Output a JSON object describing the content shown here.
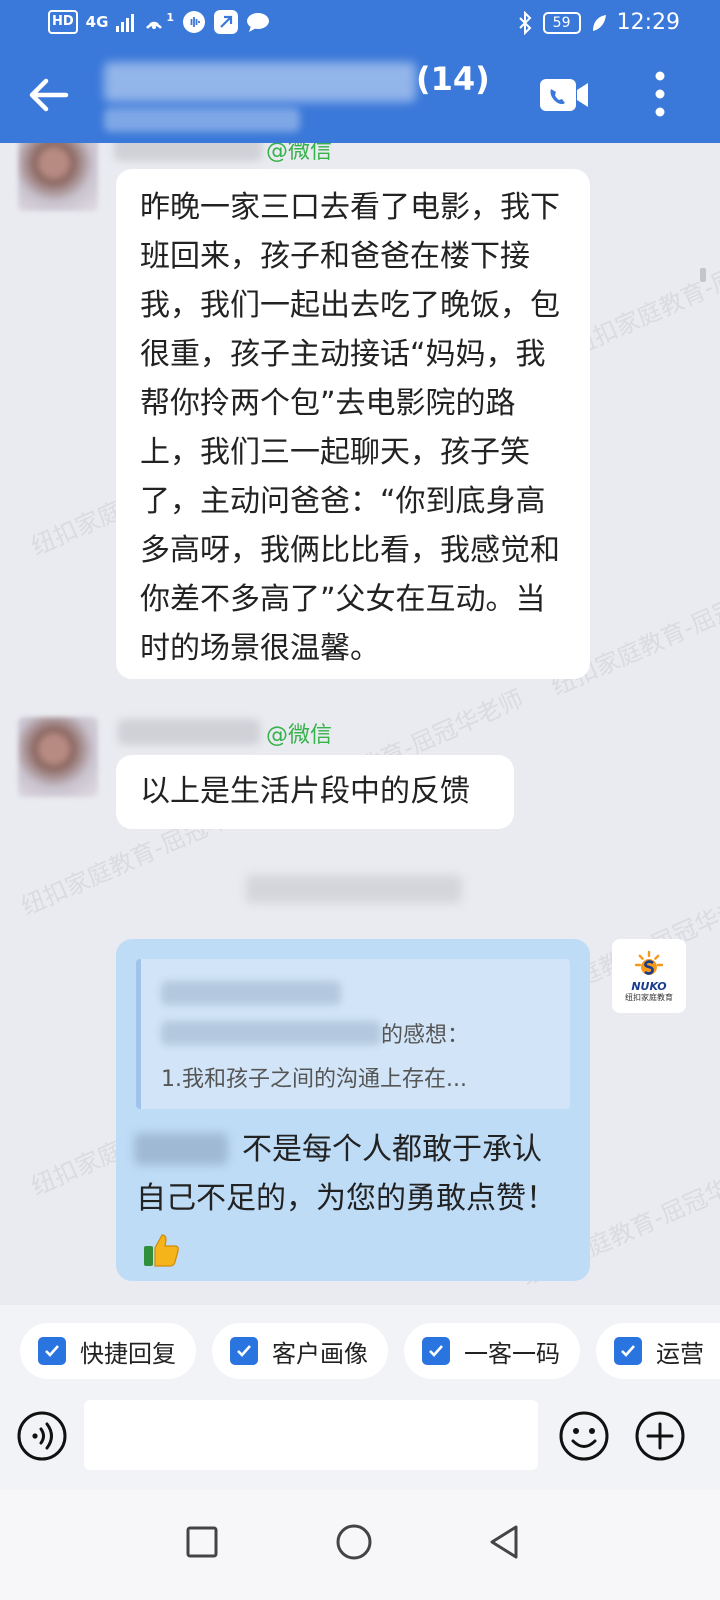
{
  "status_bar": {
    "hd": "HD",
    "network": "4G",
    "signal_sup": "1",
    "battery": "59",
    "time": "12:29"
  },
  "header": {
    "member_count": "(14)",
    "icons": {
      "back": "arrow-left-icon",
      "call": "video-call-icon",
      "more": "more-vertical-icon"
    }
  },
  "messages": [
    {
      "source_tag": "@微信",
      "text": "昨晚一家三口去看了电影，我下班回来，孩子和爸爸在楼下接我，我们一起出去吃了晚饭，包很重，孩子主动接话“妈妈，我帮你拎两个包”去电影院的路上，我们三一起聊天，孩子笑了，主动问爸爸：“你到底身高多高呀，我俩比比看，我感觉和你差不多高了”父女在互动。当时的场景很温馨。"
    },
    {
      "source_tag": "@微信",
      "text": "以上是生活片段中的反馈"
    }
  ],
  "my_message": {
    "quote_line2_suffix": "的感想：",
    "quote_line3": "1.我和孩子之间的沟通上存在...",
    "text": "不是每个人都敢于承认自己不足的，为您的勇敢点赞！",
    "emoji": "thumbs-up-icon"
  },
  "my_avatar": {
    "brand": "NUKO",
    "brand_cn": "纽扣家庭教育"
  },
  "watermark": "纽扣家庭教育-屈冠华老师",
  "quick_actions": [
    {
      "label": "快捷回复"
    },
    {
      "label": "客户画像"
    },
    {
      "label": "一客一码"
    },
    {
      "label": "运营"
    }
  ],
  "input": {
    "placeholder": ""
  },
  "colors": {
    "header": "#3a78d9",
    "bubble_mine": "#bfdcf7",
    "accent_green": "#36b24a",
    "check_blue": "#2a74e0"
  }
}
